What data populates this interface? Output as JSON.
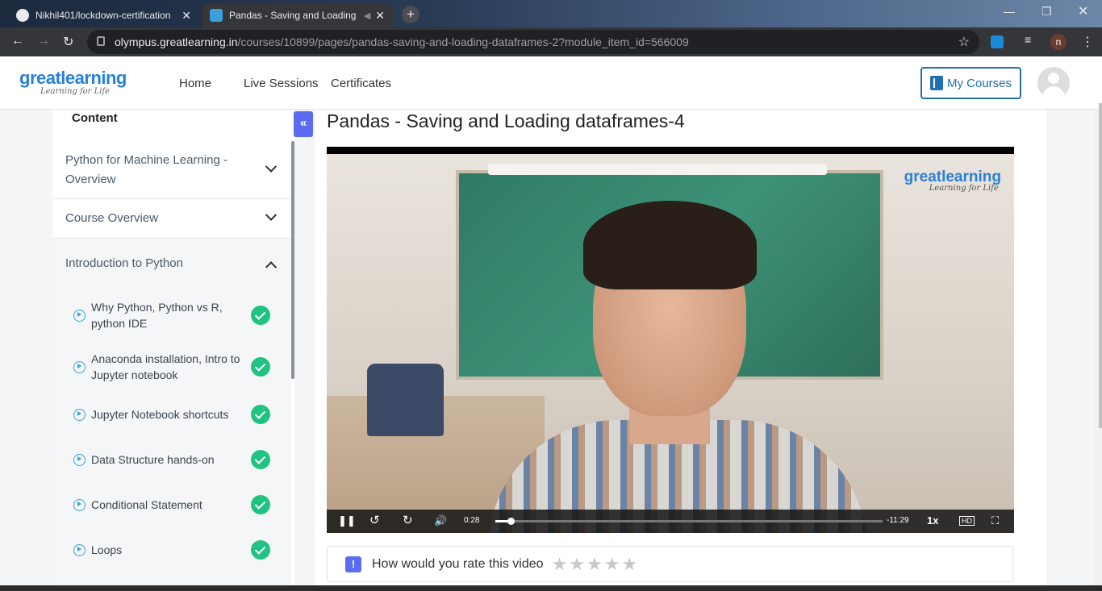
{
  "browser": {
    "tabs": [
      {
        "title": "Nikhil401/lockdown-certification",
        "icon": "github-icon"
      },
      {
        "title": "Pandas - Saving and Loading",
        "icon": "greatlearning-icon"
      }
    ],
    "url_host": "olympus.greatlearning.in",
    "url_path": "/courses/10899/pages/pandas-saving-and-loading-dataframes-2?module_item_id=566009",
    "profile_initial": "n"
  },
  "site": {
    "logo_main": "greatlearning",
    "logo_tagline": "Learning for Life",
    "nav": [
      "Home",
      "Live Sessions",
      "Certificates"
    ],
    "my_courses": "My Courses"
  },
  "sidebar": {
    "content_label": "Content",
    "collapse_glyph": "«",
    "sections": [
      {
        "label": "Python for Machine Learning - Overview",
        "state": "collapsed"
      },
      {
        "label": "Course Overview",
        "state": "collapsed"
      },
      {
        "label": "Introduction to Python",
        "state": "expanded"
      }
    ],
    "items": [
      {
        "label": "Why Python, Python vs R, python IDE",
        "completed": true
      },
      {
        "label": "Anaconda installation, Intro to Jupyter notebook",
        "completed": true
      },
      {
        "label": "Jupyter Notebook shortcuts",
        "completed": true
      },
      {
        "label": "Data Structure hands-on",
        "completed": true
      },
      {
        "label": "Conditional Statement",
        "completed": true
      },
      {
        "label": "Loops",
        "completed": true
      }
    ]
  },
  "main": {
    "title": "Pandas - Saving and Loading dataframes-4",
    "video": {
      "current_time": "0:28",
      "remaining_time": "-11:29",
      "speed": "1x",
      "progress_fraction": 0.04
    },
    "rating": {
      "icon": "!",
      "prompt": "How would you rate this video",
      "stars": 5,
      "selected": 0
    }
  },
  "colors": {
    "accent": "#5b6cf0",
    "brand_blue": "#1f6fb2",
    "complete_green": "#20c381"
  }
}
